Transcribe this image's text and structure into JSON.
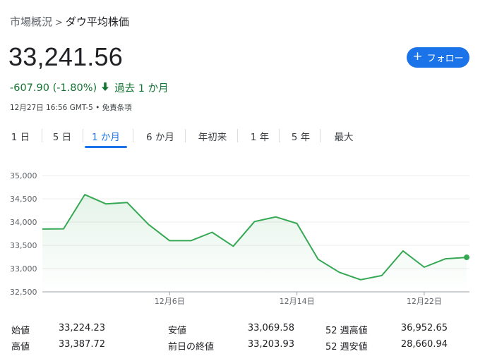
{
  "breadcrumb": {
    "parent": "市場概況",
    "separator": ">",
    "current": "ダウ平均株価"
  },
  "price": "33,241.56",
  "follow_button": {
    "label": "フォロー",
    "icon": "plus-icon"
  },
  "change": {
    "value": "-607.90 (-1.80%)",
    "direction_icon": "arrow-down-icon",
    "period": "過去 1 か月",
    "color": "#137333"
  },
  "timestamp": {
    "text": "12月27日 16:56 GMT-5",
    "separator": "•",
    "disclaimer": "免責条項"
  },
  "tabs": [
    {
      "label": "1 日",
      "active": false
    },
    {
      "label": "5 日",
      "active": false
    },
    {
      "label": "1 か月",
      "active": true
    },
    {
      "label": "6 か月",
      "active": false
    },
    {
      "label": "年初来",
      "active": false
    },
    {
      "label": "1 年",
      "active": false
    },
    {
      "label": "5 年",
      "active": false
    },
    {
      "label": "最大",
      "active": false
    }
  ],
  "chart_data": {
    "type": "area",
    "x_tick_labels": [
      "12月6日",
      "12月14日",
      "12月22日"
    ],
    "x_tick_indices": [
      6,
      12,
      18
    ],
    "y_ticks": [
      32500,
      33000,
      33500,
      34000,
      34500,
      35000
    ],
    "y_tick_labels": [
      "32,500",
      "33,000",
      "33,500",
      "34,000",
      "34,500",
      "35,000"
    ],
    "ylim": [
      32500,
      35000
    ],
    "values": [
      33850,
      33855,
      34590,
      34390,
      34420,
      33950,
      33600,
      33600,
      33780,
      33480,
      34010,
      34110,
      33970,
      33200,
      32920,
      32760,
      32850,
      33380,
      33030,
      33210,
      33241.56
    ],
    "line_color": "#34a853",
    "grid": true
  },
  "stats": {
    "rows": [
      [
        {
          "label": "始値",
          "value": "33,224.23"
        },
        {
          "label": "安値",
          "value": "33,069.58"
        },
        {
          "label": "52 週高値",
          "value": "36,952.65"
        }
      ],
      [
        {
          "label": "高値",
          "value": "33,387.72"
        },
        {
          "label": "前日の終値",
          "value": "33,203.93"
        },
        {
          "label": "52 週安値",
          "value": "28,660.94"
        }
      ]
    ]
  }
}
